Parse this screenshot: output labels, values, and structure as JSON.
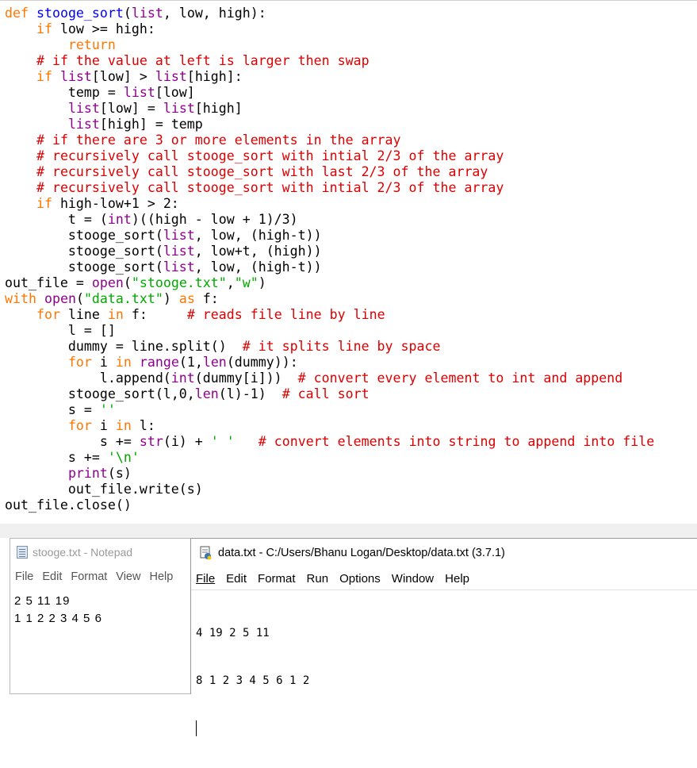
{
  "code_lines": [
    "def stooge_sort(list, low, high):",
    "    if low >= high:",
    "        return",
    "    # if the value at left is larger then swap",
    "    if list[low] > list[high]:",
    "        temp = list[low]",
    "        list[low] = list[high]",
    "        list[high] = temp",
    "    # if there are 3 or more elements in the array",
    "    # recursively call stooge_sort with intial 2/3 of the array",
    "    # recursively call stooge_sort with last 2/3 of the array",
    "    # recursively call stooge_sort with intial 2/3 of the array",
    "    if high-low+1 > 2:",
    "        t = (int)((high - low + 1)/3)",
    "        stooge_sort(list, low, (high-t))",
    "        stooge_sort(list, low+t, (high))",
    "        stooge_sort(list, low, (high-t))",
    "out_file = open(\"stooge.txt\",\"w\")",
    "with open(\"data.txt\") as f:",
    "    for line in f:     # reads file line by line",
    "        l = []",
    "        dummy = line.split()  # it splits line by space",
    "        for i in range(1,len(dummy)):",
    "            l.append(int(dummy[i]))  # convert every element to int and append",
    "        stooge_sort(l,0,len(l)-1)  # call sort",
    "        s = ''",
    "        for i in l:",
    "            s += str(i) + ' '   # convert elements into string to append into file",
    "        s += '\\n'",
    "        print(s)",
    "        out_file.write(s)",
    "out_file.close()"
  ],
  "notepad": {
    "title": "stooge.txt - Notepad",
    "menu": [
      "File",
      "Edit",
      "Format",
      "View",
      "Help"
    ],
    "lines": [
      "2 5 11 19",
      "1 1 2 2 3 4 5 6"
    ]
  },
  "idle": {
    "title": "data.txt - C:/Users/Bhanu Logan/Desktop/data.txt (3.7.1)",
    "menu": [
      "File",
      "Edit",
      "Format",
      "Run",
      "Options",
      "Window",
      "Help"
    ],
    "lines": [
      "4 19 2 5 11",
      "8 1 2 3 4 5 6 1 2"
    ]
  },
  "colors": {
    "keyword": "#ff7700",
    "builtin": "#900090",
    "string": "#00aa00",
    "comment": "#dd0000",
    "defname": "#0000ff"
  }
}
